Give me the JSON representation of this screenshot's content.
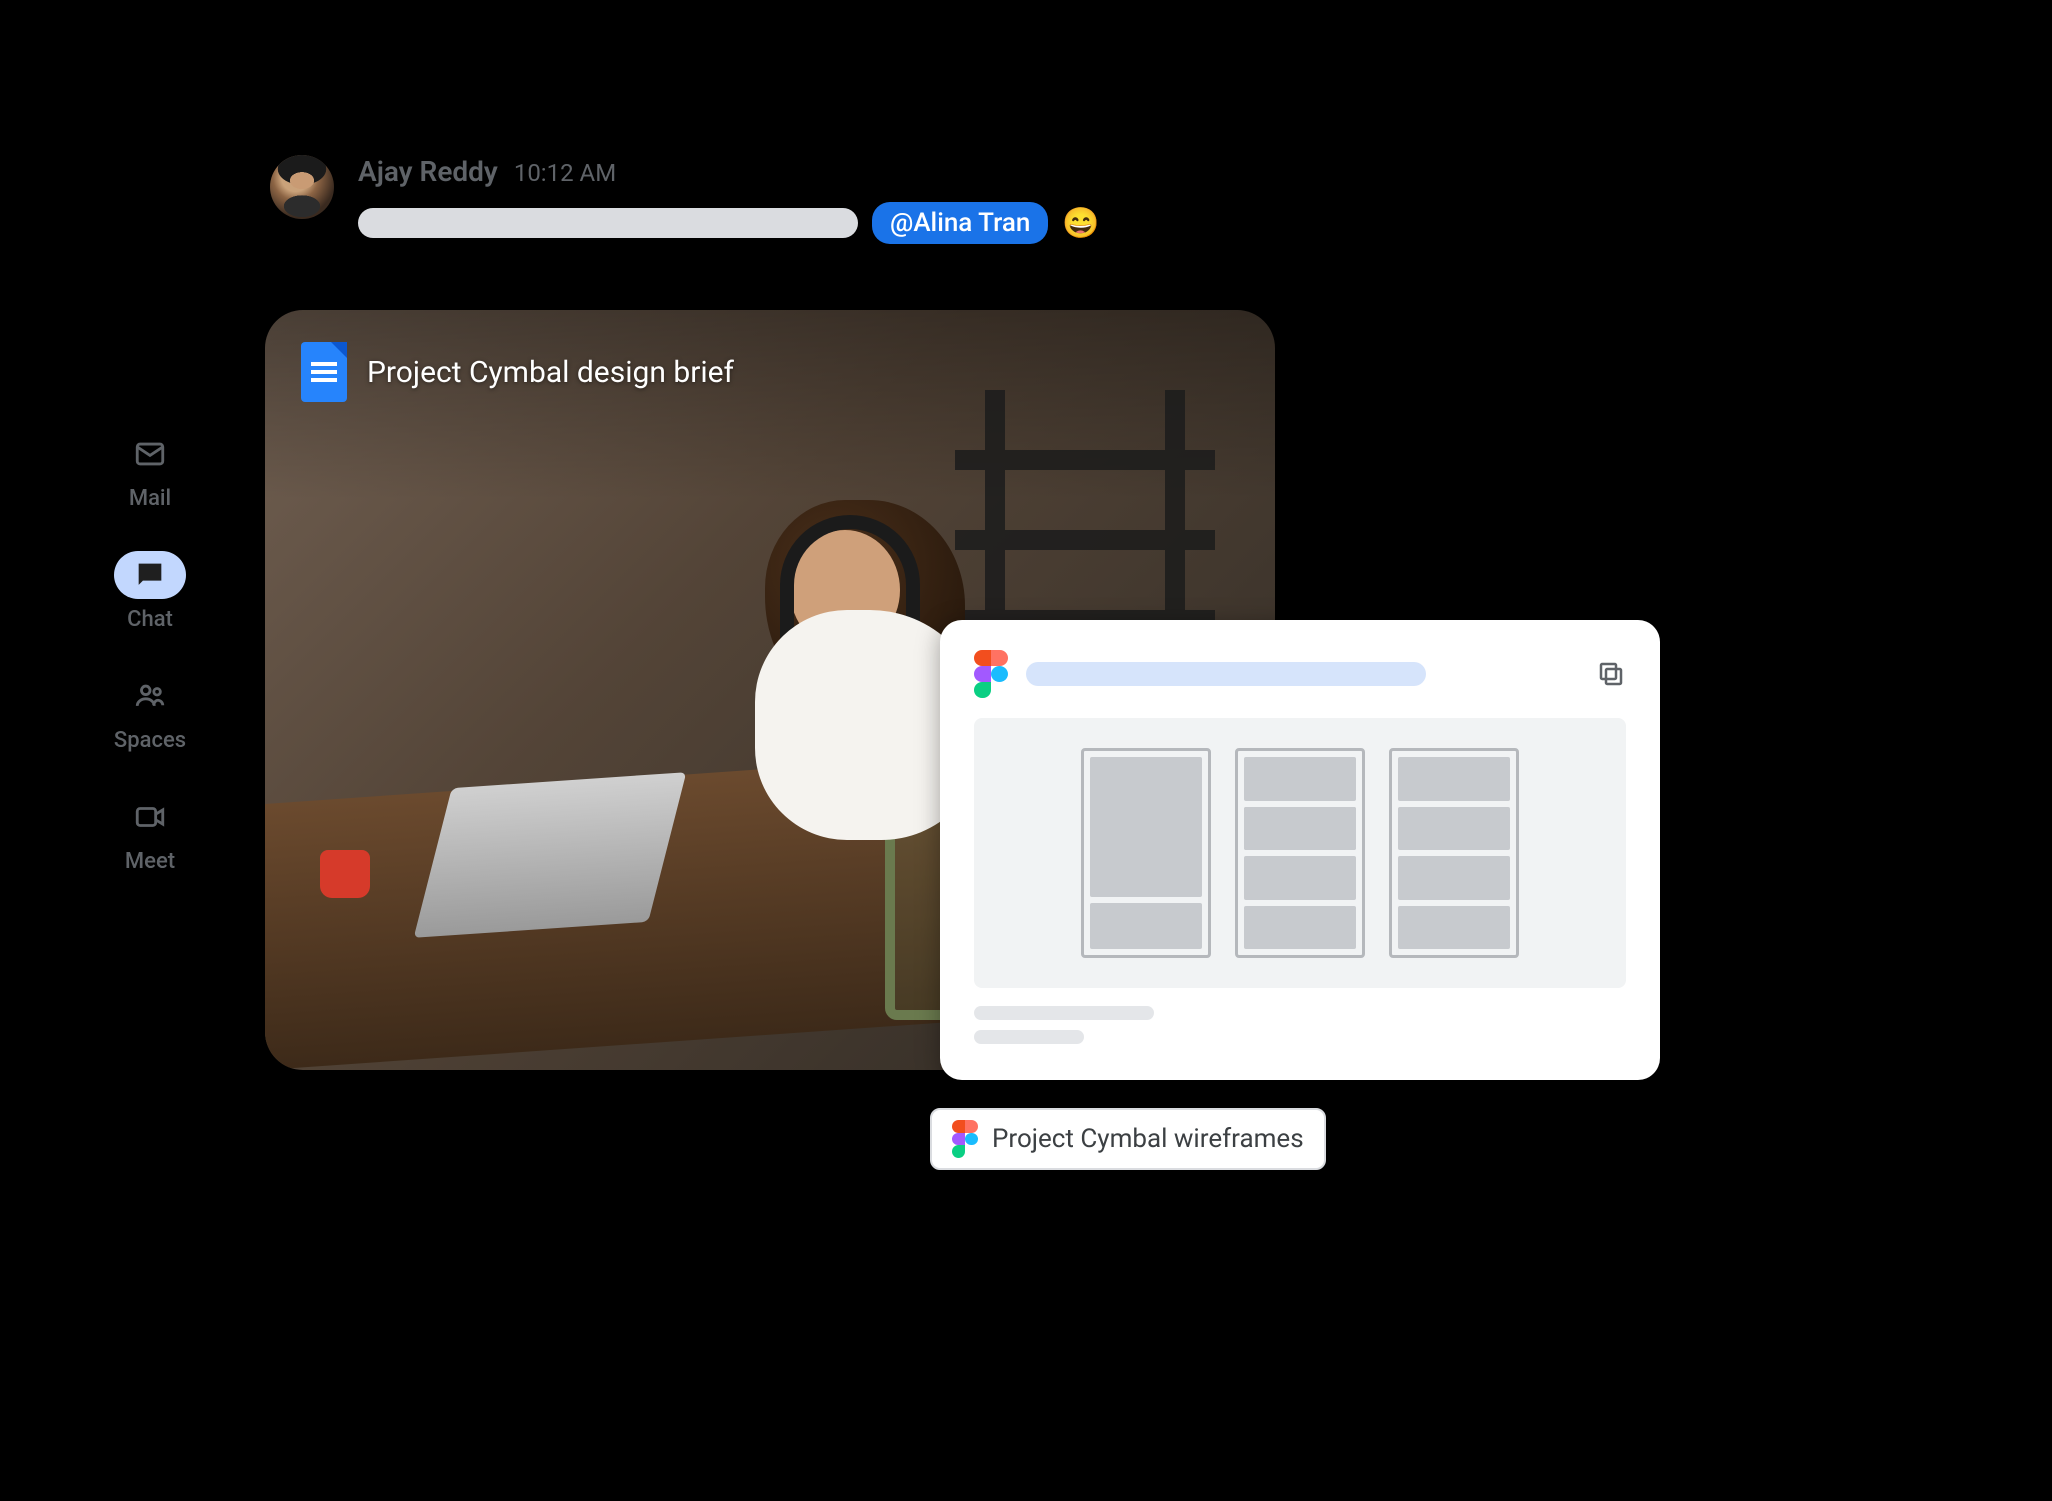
{
  "nav": {
    "items": [
      {
        "label": "Mail",
        "icon": "mail"
      },
      {
        "label": "Chat",
        "icon": "chat"
      },
      {
        "label": "Spaces",
        "icon": "groups"
      },
      {
        "label": "Meet",
        "icon": "videocam"
      }
    ],
    "active_index": 1
  },
  "message": {
    "author": "Ajay Reddy",
    "timestamp": "10:12 AM",
    "mention": "@Alina Tran",
    "reaction_emoji": "😄"
  },
  "doc_attachment": {
    "title": "Project Cymbal design brief",
    "app": "google-docs"
  },
  "figma_card": {
    "app": "figma"
  },
  "figma_chip": {
    "label": "Project Cymbal wireframes"
  }
}
